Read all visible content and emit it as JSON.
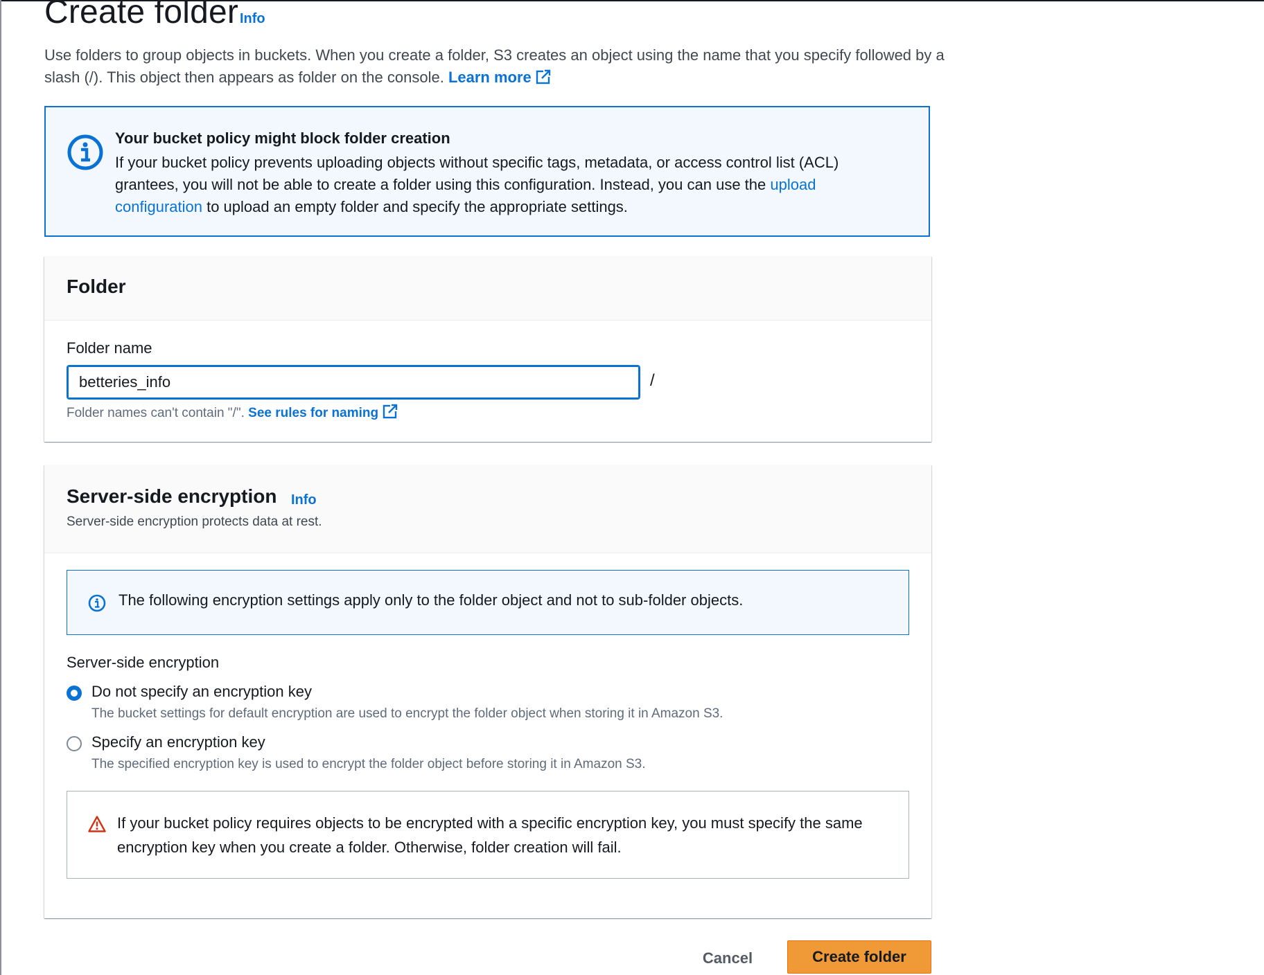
{
  "page": {
    "title": "Create folder",
    "info_label": "Info",
    "description": "Use folders to group objects in buckets. When you create a folder, S3 creates an object using the name that you specify followed by a slash (/). This object then appears as folder on the console.",
    "learn_more_label": "Learn more"
  },
  "policy_alert": {
    "title": "Your bucket policy might block folder creation",
    "body_before": "If your bucket policy prevents uploading objects without specific tags, metadata, or access control list (ACL) grantees, you will not be able to create a folder using this configuration. Instead, you can use the ",
    "link_label": "upload configuration",
    "body_after": " to upload an empty folder and specify the appropriate settings."
  },
  "folder_panel": {
    "title": "Folder",
    "name_label": "Folder name",
    "name_value": "betteries_info",
    "slash": "/",
    "hint": "Folder names can't contain \"/\". ",
    "hint_link": "See rules for naming"
  },
  "encryption_panel": {
    "title": "Server-side encryption",
    "info_label": "Info",
    "description": "Server-side encryption protects data at rest.",
    "info_alert": "The following encryption settings apply only to the folder object and not to sub-folder objects.",
    "field_label": "Server-side encryption",
    "options": [
      {
        "label": "Do not specify an encryption key",
        "description": "The bucket settings for default encryption are used to encrypt the folder object when storing it in Amazon S3.",
        "selected": true
      },
      {
        "label": "Specify an encryption key",
        "description": "The specified encryption key is used to encrypt the folder object before storing it in Amazon S3.",
        "selected": false
      }
    ],
    "warning": "If your bucket policy requires objects to be encrypted with a specific encryption key, you must specify the same encryption key when you create a folder. Otherwise, folder creation will fail."
  },
  "actions": {
    "cancel_label": "Cancel",
    "create_label": "Create folder"
  },
  "colors": {
    "link": "#0972d3",
    "primary_button": "#f09a37",
    "info_bg": "#f2f8fd",
    "warning_icon": "#d13212"
  },
  "icons": {
    "info": "info-circle-icon",
    "external": "external-link-icon",
    "warning": "warning-triangle-icon"
  }
}
